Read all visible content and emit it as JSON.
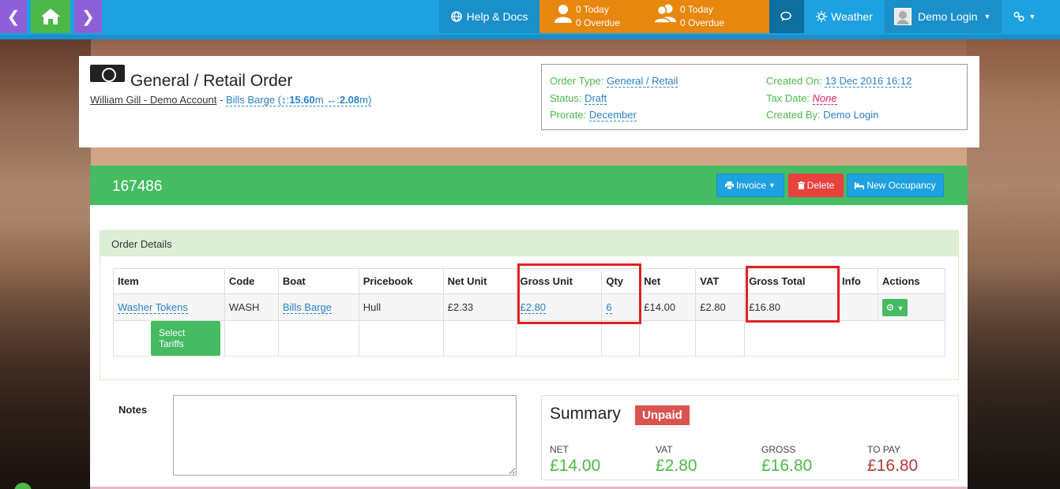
{
  "topbar": {
    "back_icon": "chevron-left-icon",
    "home_icon": "home-icon",
    "forward_icon": "chevron-right-icon",
    "help_label": "Help & Docs",
    "counter1": {
      "today": "0 Today",
      "overdue": "0 Overdue"
    },
    "counter2": {
      "today": "0 Today",
      "overdue": "0 Overdue"
    },
    "weather_label": "Weather",
    "user_label": "Demo Login"
  },
  "header": {
    "title": "General / Retail Order",
    "account": "William Gill - Demo Account",
    "separator": "-",
    "boat": "Bills Barge",
    "length": "15.60",
    "beam": "2.08",
    "unit": "m",
    "order_type_label": "Order Type:",
    "order_type": "General / Retail",
    "status_label": "Status:",
    "status": "Draft",
    "prorate_label": "Prorate:",
    "prorate": "December",
    "created_on_label": "Created On:",
    "created_on": "13 Dec 2016 16:12",
    "tax_date_label": "Tax Date:",
    "tax_date": "None",
    "created_by_label": "Created By:",
    "created_by": "Demo Login"
  },
  "panel": {
    "order_id": "167486",
    "invoice_label": "Invoice",
    "delete_label": "Delete",
    "new_occupancy_label": "New Occupancy"
  },
  "details": {
    "title": "Order Details",
    "columns": [
      "Item",
      "Code",
      "Boat",
      "Pricebook",
      "Net Unit",
      "Gross Unit",
      "Qty",
      "Net",
      "VAT",
      "Gross Total",
      "Info",
      "Actions"
    ],
    "row": {
      "item": "Washer Tokens",
      "code": "WASH",
      "boat": "Bills Barge",
      "pricebook": "Hull",
      "net_unit": "£2.33",
      "gross_unit": "£2.80",
      "qty": "6",
      "net": "£14.00",
      "vat": "£2.80",
      "gross_total": "£16.80",
      "info": ""
    },
    "select_tariffs_label": "Select Tariffs"
  },
  "notes": {
    "label": "Notes",
    "value": ""
  },
  "summary": {
    "title": "Summary",
    "badge": "Unpaid",
    "net_label": "NET",
    "net": "£14.00",
    "vat_label": "VAT",
    "vat": "£2.80",
    "gross_label": "GROSS",
    "gross": "£16.80",
    "to_pay_label": "TO PAY",
    "to_pay": "£16.80"
  },
  "colors": {
    "topbar": "#1da1e0",
    "accent_green": "#45bb62",
    "accent_orange": "#e8870e",
    "accent_purple": "#8e5fd6",
    "danger": "#e8413e",
    "highlight": "#e0211f"
  }
}
